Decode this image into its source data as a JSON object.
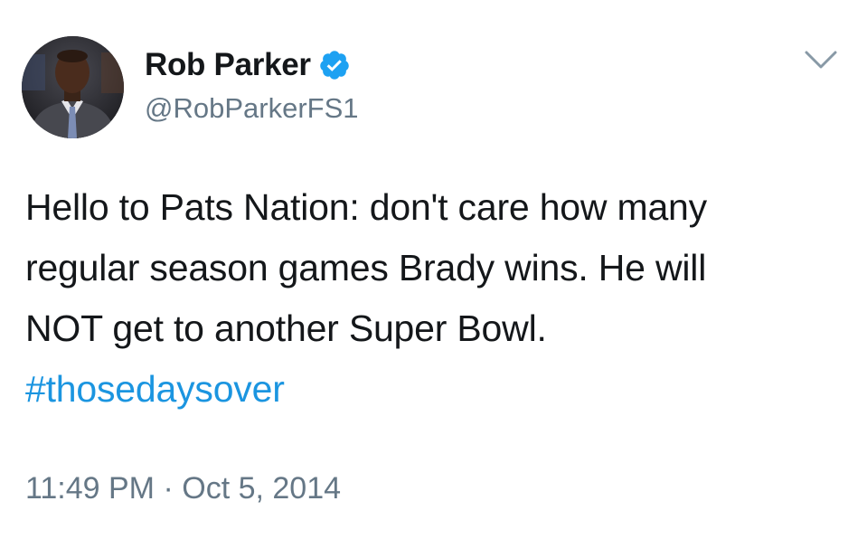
{
  "tweet": {
    "author": {
      "display_name": "Rob Parker",
      "handle": "@RobParkerFS1",
      "verified": true,
      "avatar_icon": "avatar-photo"
    },
    "text_lines": [
      "Hello to Pats Nation: don't care how many",
      "regular season games Brady wins. He will",
      "NOT get to another Super Bowl."
    ],
    "hashtag": "#thosedaysover",
    "time": "11:49 PM",
    "separator": "·",
    "date": "Oct 5, 2014",
    "menu_icon": "chevron-down-icon"
  },
  "colors": {
    "text": "#14171a",
    "secondary": "#657786",
    "link": "#1b95e0",
    "verified": "#1da1f2"
  }
}
